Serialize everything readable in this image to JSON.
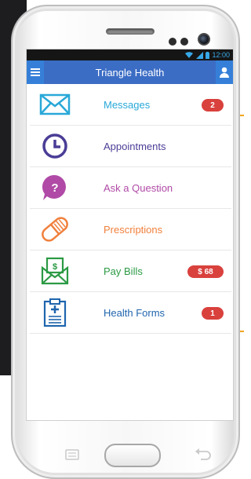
{
  "status_bar": {
    "time": "12:00"
  },
  "app_bar": {
    "title": "Triangle Health",
    "menu_icon": "hamburger-icon",
    "profile_icon": "person-icon"
  },
  "menu": [
    {
      "id": "messages",
      "label": "Messages",
      "icon": "envelope-icon",
      "color": "#29a8d8",
      "badge": "2"
    },
    {
      "id": "appointments",
      "label": "Appointments",
      "icon": "clock-icon",
      "color": "#4a3d96",
      "badge": null
    },
    {
      "id": "ask",
      "label": "Ask a Question",
      "icon": "question-bubble-icon",
      "color": "#b04aa6",
      "badge": null
    },
    {
      "id": "prescriptions",
      "label": "Prescriptions",
      "icon": "pill-icon",
      "color": "#f0803c",
      "badge": null
    },
    {
      "id": "bills",
      "label": "Pay Bills",
      "icon": "money-envelope-icon",
      "color": "#2b9a44",
      "badge": "$ 68"
    },
    {
      "id": "forms",
      "label": "Health Forms",
      "icon": "clipboard-icon",
      "color": "#1f65ad",
      "badge": "1"
    }
  ],
  "colors": {
    "app_bar": "#3c6dc5",
    "badge": "#d9413d",
    "callout": "#f2a51d"
  }
}
